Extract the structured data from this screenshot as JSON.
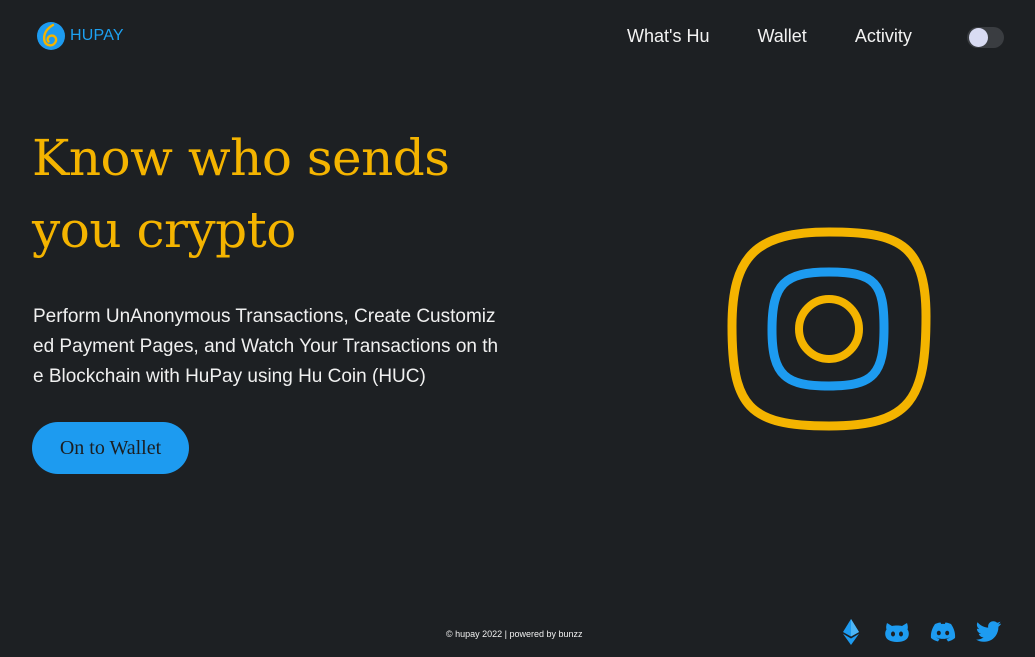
{
  "header": {
    "logo_text": "HUPAY",
    "nav": [
      {
        "label": "What's Hu"
      },
      {
        "label": "Wallet"
      },
      {
        "label": "Activity"
      }
    ],
    "theme_toggle": {
      "state": "off"
    }
  },
  "hero": {
    "title_line1": "Know who sends",
    "title_line2": "you crypto",
    "subtitle": "Perform UnAnonymous Transactions, Create Customized Payment Pages, and Watch Your Transactions on the Blockchain with HuPay using Hu Coin (HUC)",
    "cta_label": "On to Wallet"
  },
  "footer": {
    "copyright": "© hupay 2022 | powered by bunzz",
    "social_icons": [
      "ethereum-icon",
      "github-icon",
      "discord-icon",
      "twitter-icon"
    ]
  },
  "colors": {
    "background": "#1d2023",
    "accent_yellow": "#f4b400",
    "accent_blue": "#1d9bf0",
    "text": "#f0f0f0"
  }
}
